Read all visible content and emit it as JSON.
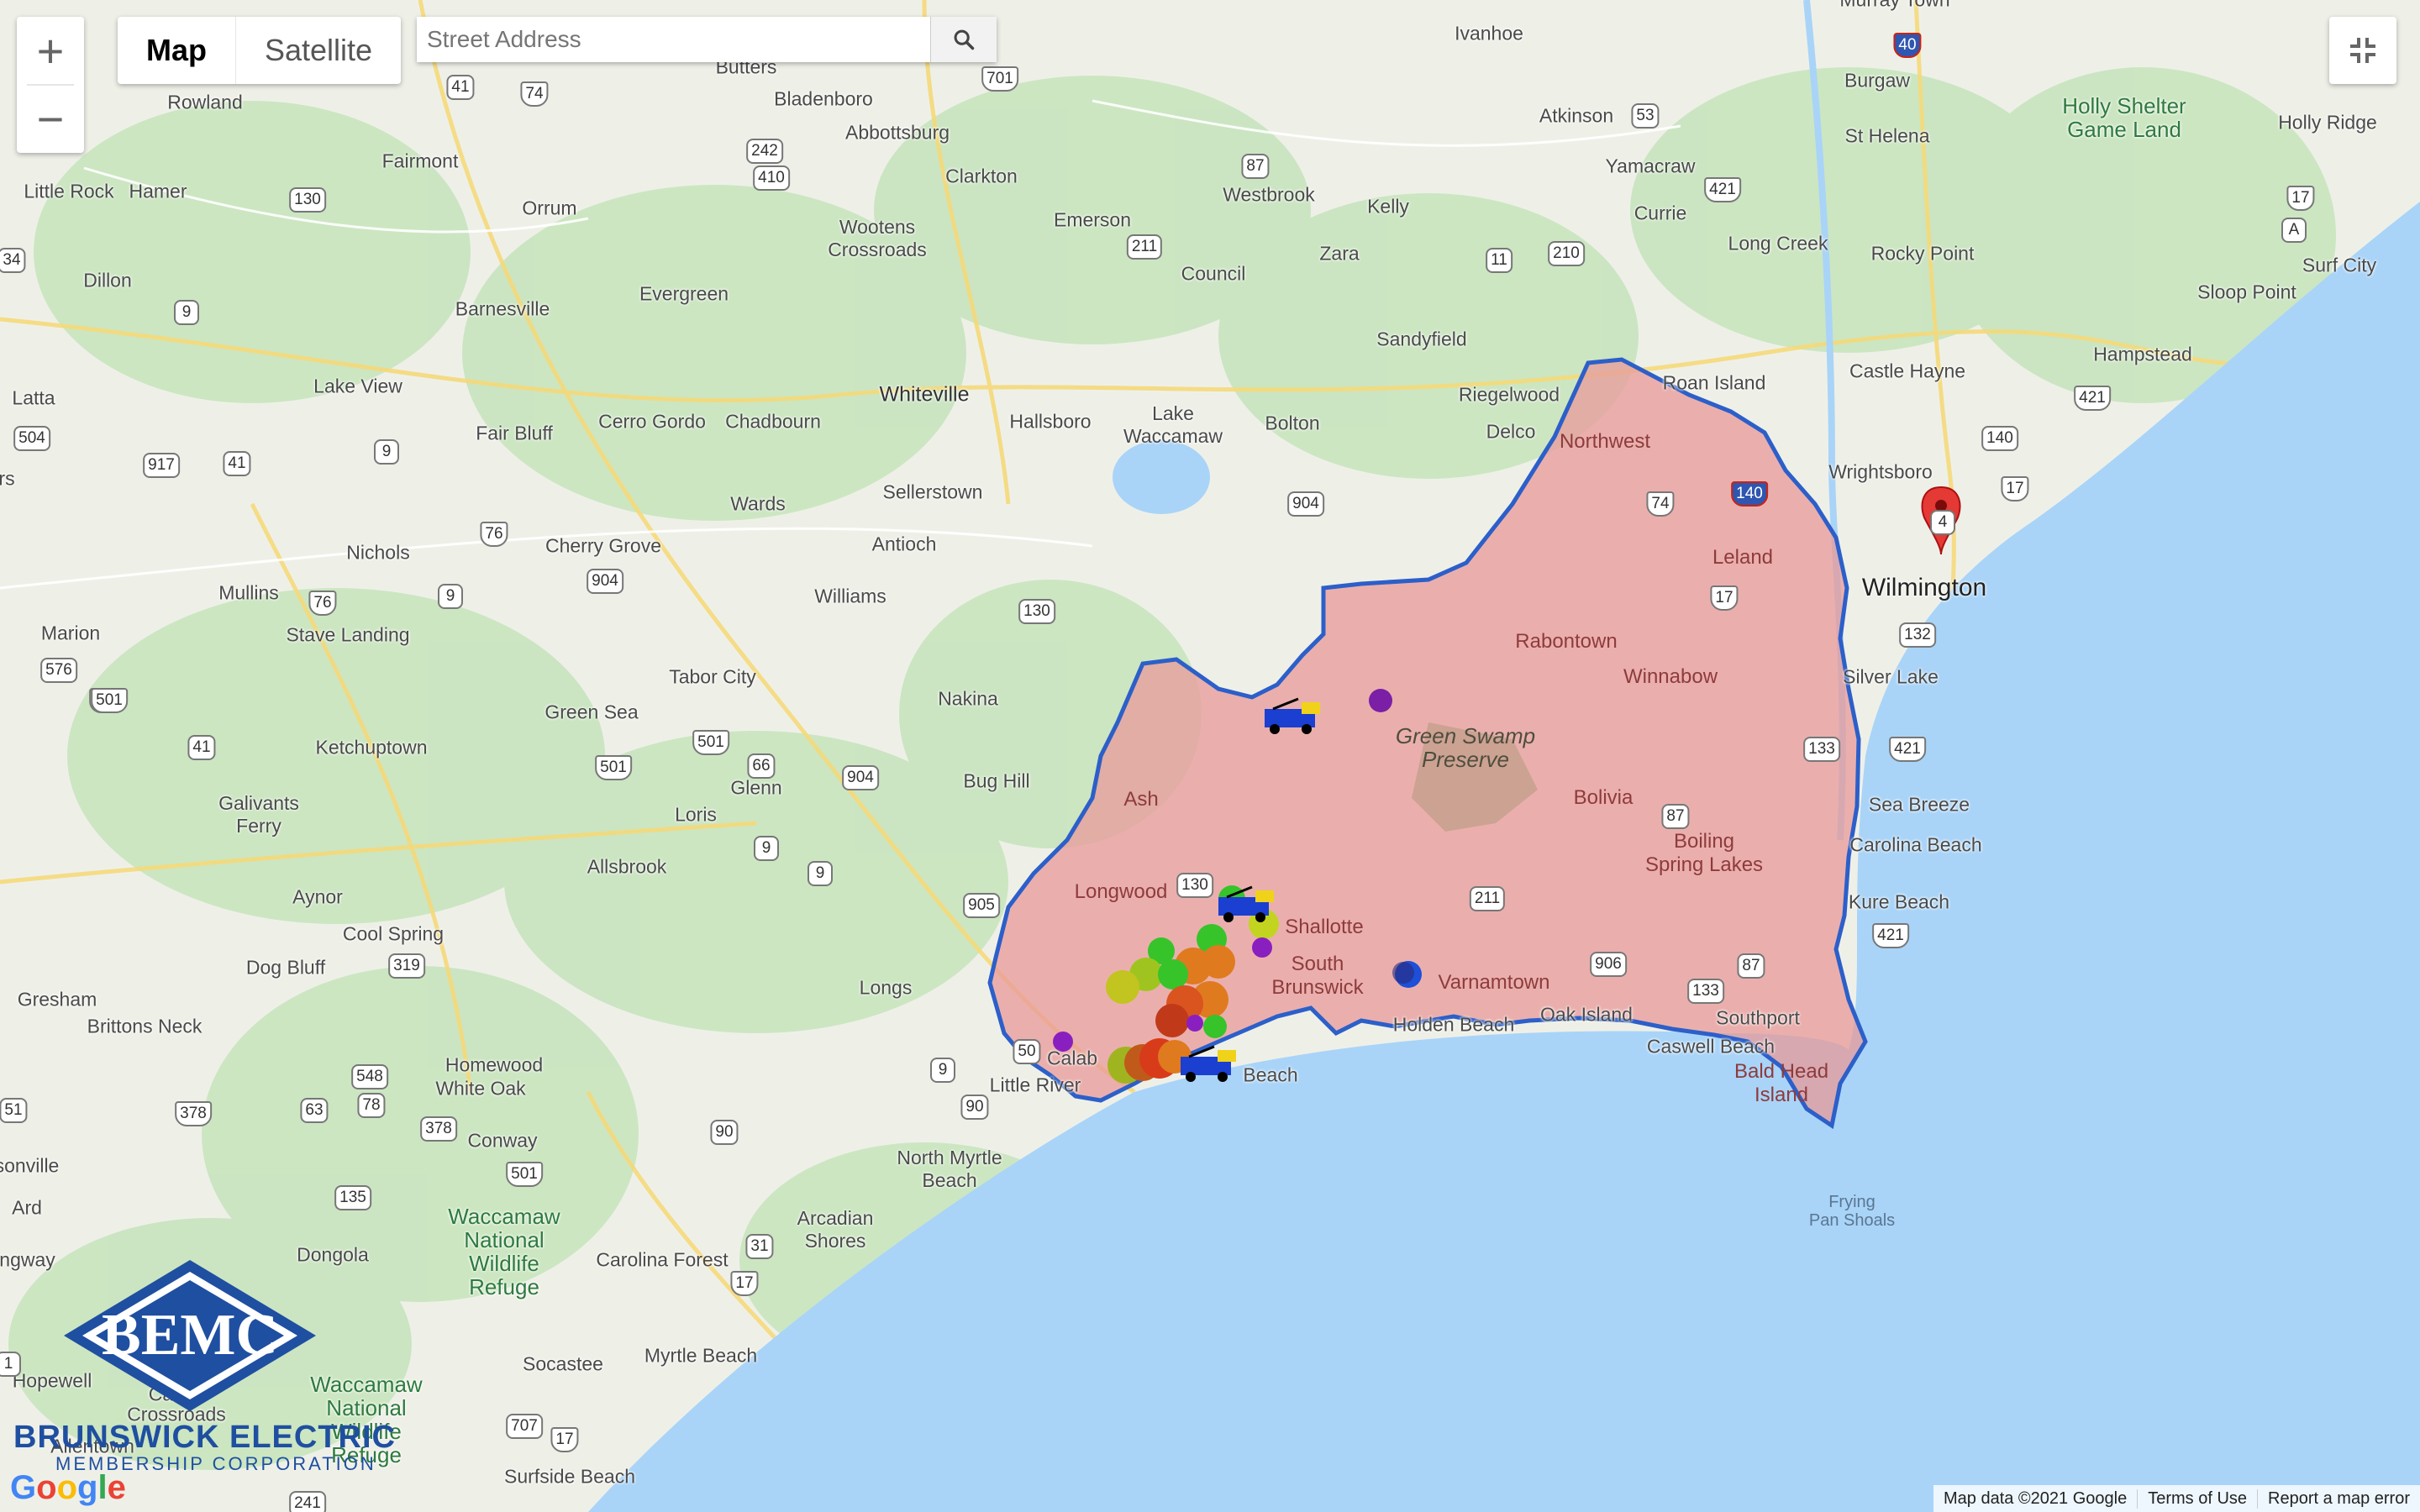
{
  "map": {
    "type_buttons": [
      "Map",
      "Satellite"
    ],
    "search_placeholder": "Street Address",
    "zoom_in": "+",
    "zoom_out": "−",
    "labels": {
      "butters": "Butters",
      "bladenboro": "Bladenboro",
      "abbottsburg": "Abbottsburg",
      "clarkton": "Clarkton",
      "ivanhoe": "Ivanhoe",
      "murray_town": "Murray Town",
      "burgaw": "Burgaw",
      "st_helena": "St Helena",
      "holly_shelter": "Holly Shelter\nGame Land",
      "holly_ridge": "Holly Ridge",
      "rowland": "Rowland",
      "fairmont": "Fairmont",
      "little_rock": "Little Rock",
      "hamer": "Hamer",
      "orrum": "Orrum",
      "wootens": "Wootens\nCrossroads",
      "emerson": "Emerson",
      "westbrook": "Westbrook",
      "kelly": "Kelly",
      "atkinson": "Atkinson",
      "yamacraw": "Yamacraw",
      "currie": "Currie",
      "long_creek": "Long Creek",
      "rocky_point": "Rocky Point",
      "surf_city": "Surf City",
      "sloop_point": "Sloop Point",
      "dillon": "Dillon",
      "barnesville": "Barnesville",
      "evergreen": "Evergreen",
      "council": "Council",
      "zara": "Zara",
      "sandyfield": "Sandyfield",
      "hampstead": "Hampstead",
      "castle_hayne": "Castle Hayne",
      "lake_view": "Lake View",
      "latta": "Latta",
      "fair_bluff": "Fair Bluff",
      "cerro_gordo": "Cerro Gordo",
      "chadbourn": "Chadbourn",
      "whiteville": "Whiteville",
      "hallsboro": "Hallsboro",
      "lake_waccamaw": "Lake\nWaccamaw",
      "bolton": "Bolton",
      "riegelwood": "Riegelwood",
      "delco": "Delco",
      "roan_island": "Roan Island",
      "northwest": "Northwest",
      "wrightsboro": "Wrightsboro",
      "wards": "Wards",
      "sellerstown": "Sellerstown",
      "nichols": "Nichols",
      "cherry_grove": "Cherry Grove",
      "antioch": "Antioch",
      "leland": "Leland",
      "wilmington": "Wilmington",
      "mullins": "Mullins",
      "williams": "Williams",
      "stave_landing": "Stave Landing",
      "marion": "Marion",
      "rabontown": "Rabontown",
      "tabor_city": "Tabor City",
      "nakina": "Nakina",
      "winnabow": "Winnabow",
      "silver_lake": "Silver Lake",
      "green_swamp": "Green Swamp\nPreserve",
      "green_sea": "Green Sea",
      "ketchuptown": "Ketchuptown",
      "glenn": "Glenn",
      "loris": "Loris",
      "bug_hill": "Bug Hill",
      "ash": "Ash",
      "bolivia": "Bolivia",
      "sea_breeze": "Sea Breeze",
      "galivants": "Galivants\nFerry",
      "carolina_beach": "Carolina Beach",
      "boiling_spring": "Boiling\nSpring Lakes",
      "allsbrook": "Allsbrook",
      "longwood": "Longwood",
      "shallotte": "Shallotte",
      "aynor": "Aynor",
      "kure_beach": "Kure Beach",
      "cool_spring": "Cool Spring",
      "dog_bluff": "Dog Bluff",
      "longs": "Longs",
      "south_brunswick": "South\nBrunswick",
      "varnamtown": "Varnamtown",
      "gresham": "Gresham",
      "southport": "Southport",
      "holden_beach": "Holden Beach",
      "oak_island": "Oak Island",
      "brittons_neck": "Brittons Neck",
      "caswell_beach": "Caswell Beach",
      "homewood": "Homewood",
      "white_oak": "White Oak",
      "bald_head": "Bald Head\nIsland",
      "little_river": "Little River",
      "calabash": "Calab",
      "ocean_beach": "Beach",
      "conway": "Conway",
      "north_myrtle": "North Myrtle\nBeach",
      "frying_pan": "Frying\nPan Shoals",
      "sonville": "sonville",
      "ard": "Ard",
      "waccamaw_refuge1": "Waccamaw\nNational\nWildlife\nRefuge",
      "arcadian": "Arcadian\nShores",
      "dongola": "Dongola",
      "carolina_forest": "Carolina Forest",
      "ingway": "ingway",
      "hopewell": "Hopewell",
      "socastee": "Socastee",
      "myrtle_beach": "Myrtle Beach",
      "waccamaw_refuge2": "Waccamaw\nNational\nWildlife\nRefuge",
      "allentown": "Allentown",
      "surfside": "Surfside Beach",
      "crossroads": "Crossroads",
      "cades": "Cades",
      "frs": "rs"
    },
    "shields": [
      "41",
      "74",
      "701",
      "242",
      "410",
      "87",
      "130",
      "211",
      "53",
      "421",
      "17",
      "210",
      "11",
      "40",
      "140",
      "74",
      "140",
      "17",
      "132",
      "133",
      "87",
      "906",
      "133",
      "87",
      "421",
      "421",
      "504",
      "9",
      "917",
      "41",
      "501",
      "576",
      "76",
      "904",
      "76",
      "9",
      "904",
      "130",
      "501",
      "66",
      "904",
      "9",
      "9",
      "905",
      "130",
      "211",
      "319",
      "548",
      "78",
      "63",
      "378",
      "378",
      "501",
      "135",
      "90",
      "31",
      "17",
      "50",
      "9",
      "90",
      "707",
      "17",
      "501",
      "501",
      "41",
      "9",
      "51",
      "1",
      "34",
      "4",
      "17",
      "241",
      "A",
      "421"
    ],
    "outages": {
      "legend": "outage-markers"
    },
    "attribution": {
      "map_data": "Map data ©2021 Google",
      "terms": "Terms of Use",
      "report": "Report a map error"
    },
    "google_logo": [
      "G",
      "o",
      "o",
      "g",
      "l",
      "e"
    ]
  },
  "brand": {
    "logo_letters": "BEMC",
    "name": "BRUNSWICK ELECTRIC",
    "sub": "MEMBERSHIP CORPORATION"
  },
  "colors": {
    "territory_fill": "#e89a9a",
    "territory_stroke": "#2c5fc9",
    "water": "#a9d4f8",
    "land": "#eef0e8",
    "forest": "#c9e5c0",
    "pin": "#e53935",
    "brand": "#1f4fa0"
  }
}
